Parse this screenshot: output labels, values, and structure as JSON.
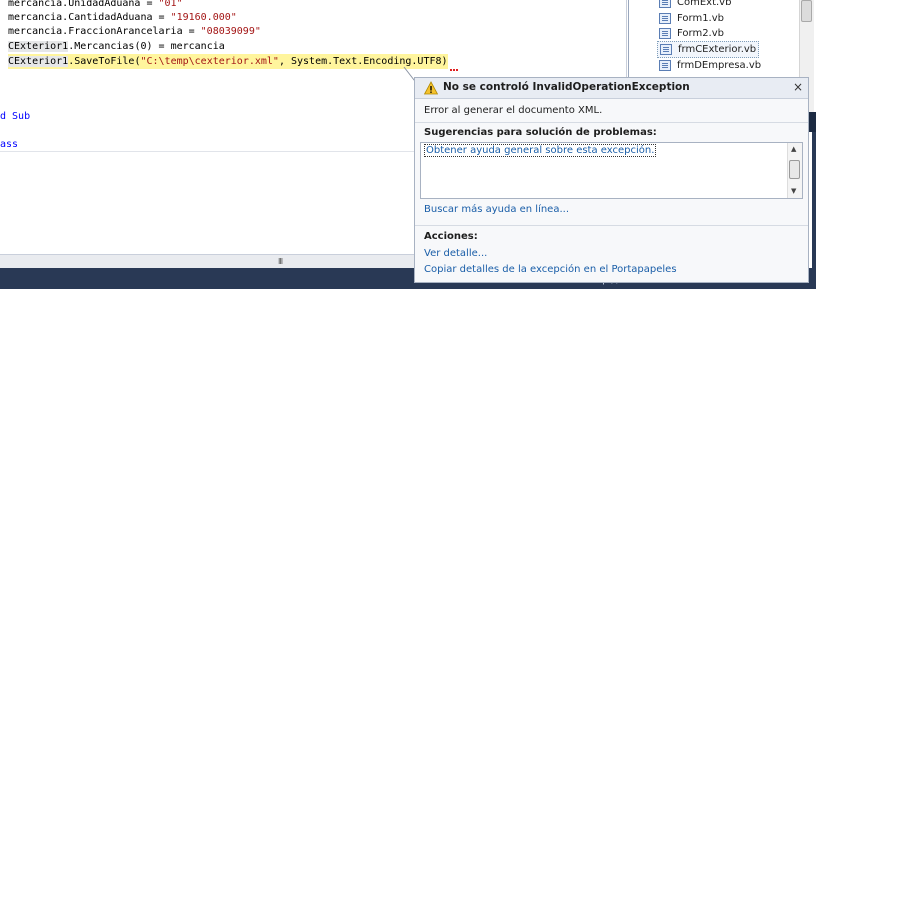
{
  "editor": {
    "lines": [
      {
        "prefix": "mercancia.UnidadAduana = ",
        "str": "\"01\"",
        "suffix": ""
      },
      {
        "prefix": "mercancia.CantidadAduana = ",
        "str": "\"19160.000\"",
        "suffix": ""
      },
      {
        "prefix": "mercancia.FraccionArancelaria = ",
        "str": "\"08039099\"",
        "suffix": ""
      }
    ],
    "line4_obj": "CExterior1",
    "line4_rest": ".Mercancias(0) = mercancia",
    "line5_obj": "CExterior1",
    "line5_method": ".SaveToFile(",
    "line5_str": "\"C:\\temp\\cexterior.xml\"",
    "line5_rest": ", System.Text.Encoding.UTF8)",
    "end_sub": "d Sub",
    "end_class": "ass",
    "hscroll_grip": "III"
  },
  "solution_explorer": {
    "items": [
      {
        "name": "ComExt.vb",
        "selected": false
      },
      {
        "name": "Form1.vb",
        "selected": false
      },
      {
        "name": "Form2.vb",
        "selected": false
      },
      {
        "name": "frmCExterior.vb",
        "selected": true
      },
      {
        "name": "frmDEmpresa.vb",
        "selected": false
      }
    ]
  },
  "statusbar": {
    "icons": "− † ×"
  },
  "exception": {
    "title": "No se controló InvalidOperationException",
    "close_label": "×",
    "message": "Error al generar el documento XML.",
    "suggestions_header": "Sugerencias para solución de problemas:",
    "suggestion_item": "Obtener ayuda general sobre esta excepción.",
    "more_help_link": "Buscar más ayuda en línea...",
    "actions_header": "Acciones:",
    "actions": [
      "Ver detalle...",
      "Copiar detalles de la excepción en el Portapapeles"
    ]
  },
  "colors": {
    "highlight": "#fff59d",
    "link": "#1a5ea8",
    "statusbar": "#293955",
    "string": "#a31515"
  }
}
